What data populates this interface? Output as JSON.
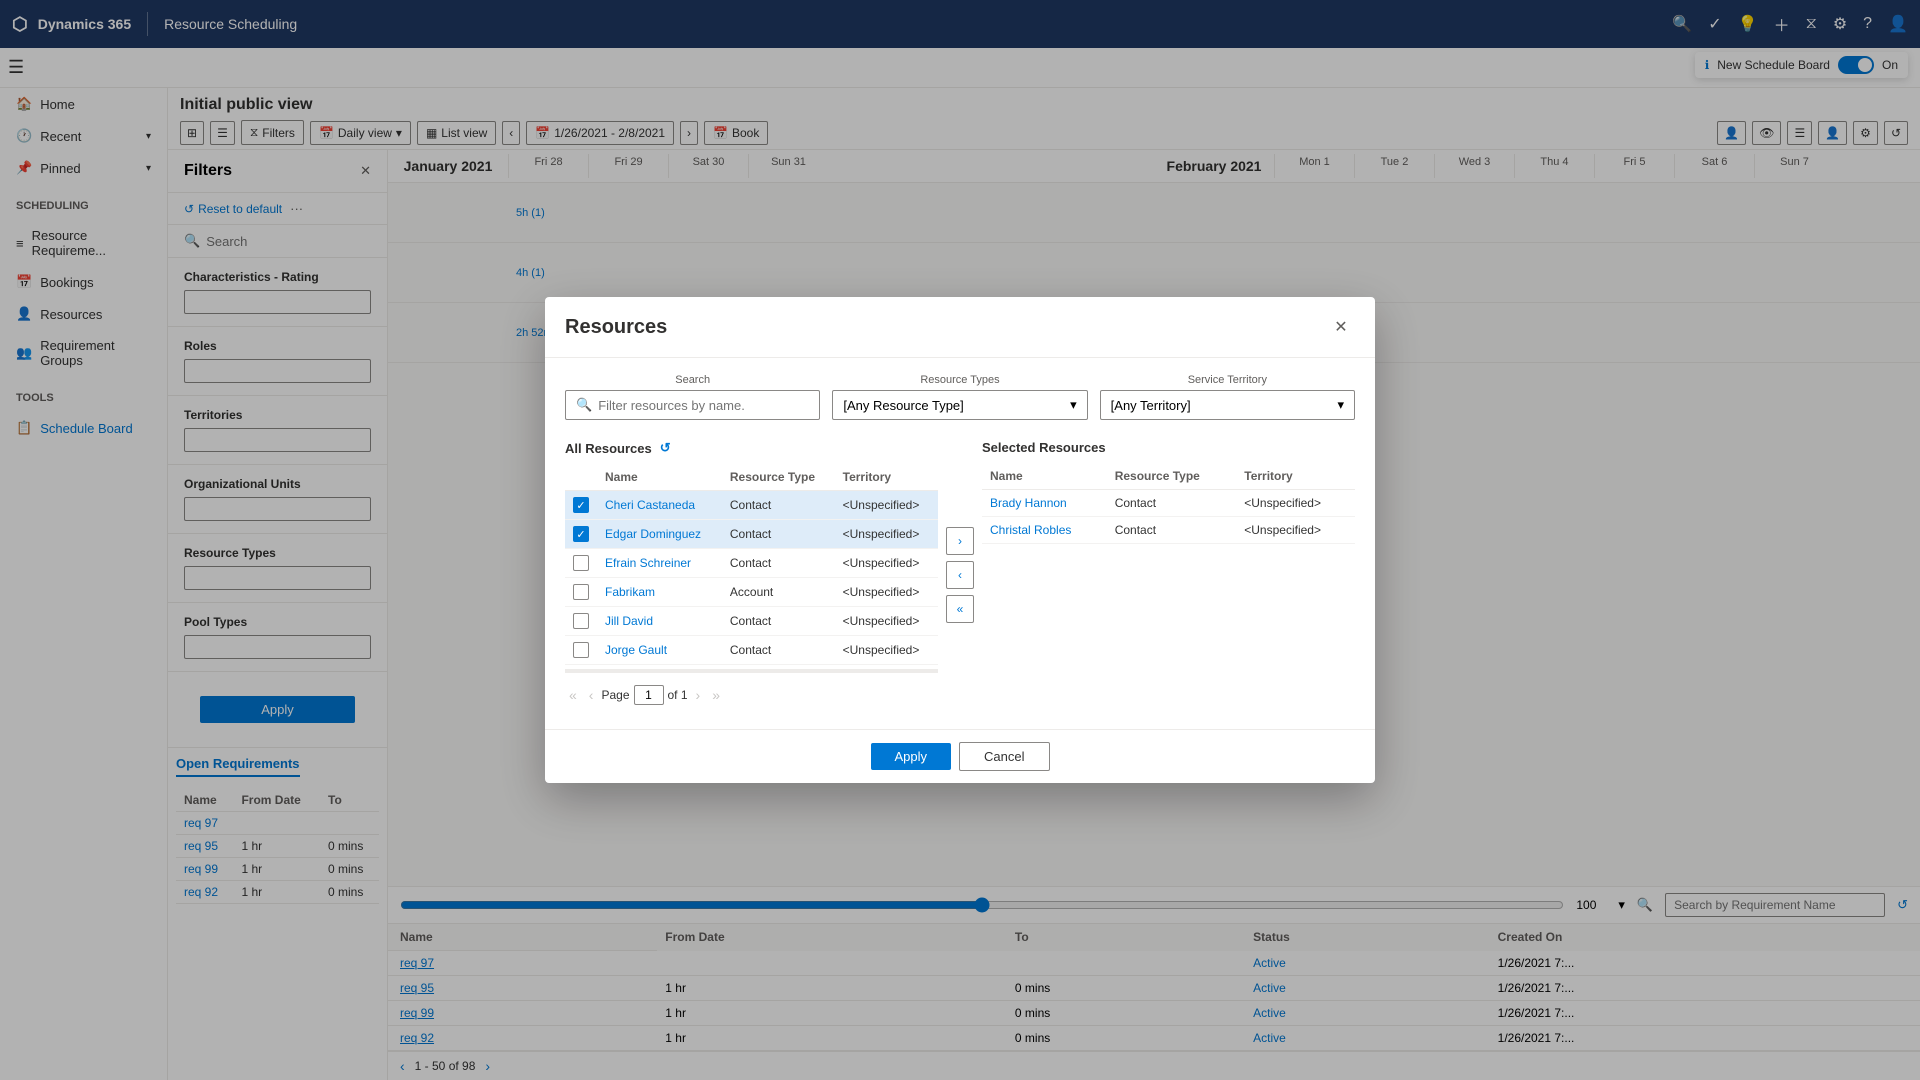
{
  "app": {
    "name": "Dynamics 365",
    "module": "Resource Scheduling"
  },
  "topbar": {
    "new_schedule_board_label": "New Schedule Board",
    "toggle_state": "On"
  },
  "sidebar": {
    "items": [
      {
        "id": "home",
        "label": "Home",
        "icon": "🏠"
      },
      {
        "id": "recent",
        "label": "Recent",
        "icon": "🕐",
        "hasChevron": true
      },
      {
        "id": "pinned",
        "label": "Pinned",
        "icon": "📌",
        "hasChevron": true
      },
      {
        "id": "scheduling",
        "label": "Scheduling",
        "isSection": true
      },
      {
        "id": "resource-req",
        "label": "Resource Requireme...",
        "icon": "≡"
      },
      {
        "id": "bookings",
        "label": "Bookings",
        "icon": "📅"
      },
      {
        "id": "resources",
        "label": "Resources",
        "icon": "👤"
      },
      {
        "id": "req-groups",
        "label": "Requirement Groups",
        "icon": "👥"
      },
      {
        "id": "tools",
        "label": "Tools",
        "isSection": true
      },
      {
        "id": "schedule-board",
        "label": "Schedule Board",
        "icon": "📋",
        "active": true
      }
    ]
  },
  "board": {
    "page_title": "Initial public view",
    "toolbar": {
      "filters_label": "Filters",
      "daily_view_label": "Daily view",
      "list_view_label": "List view",
      "date_range": "1/26/2021 - 2/8/2021",
      "book_label": "Book"
    }
  },
  "filters_panel": {
    "title": "Filters",
    "reset_label": "Reset to default",
    "sections": [
      {
        "label": "Characteristics - Rating"
      },
      {
        "label": "Roles"
      },
      {
        "label": "Territories"
      },
      {
        "label": "Organizational Units"
      },
      {
        "label": "Resource Types"
      },
      {
        "label": "Pool Types"
      }
    ],
    "apply_label": "Apply"
  },
  "open_requirements": {
    "title": "Open Requirements",
    "columns": [
      "Name",
      "From Date",
      "To",
      ""
    ],
    "rows": [
      {
        "name": "req 97",
        "from_date": "",
        "to": "",
        "mins": "",
        "hr": ""
      },
      {
        "name": "req 95",
        "from_date": "1 hr",
        "to": "0 mins",
        "mins": "0 mins",
        "hr": "1 hr"
      },
      {
        "name": "req 99",
        "from_date": "1 hr",
        "to": "0 mins",
        "mins": "0 mins",
        "hr": "1 hr"
      },
      {
        "name": "req 92",
        "from_date": "1 hr",
        "to": "0 mins",
        "mins": "0 mins",
        "hr": "1 hr"
      }
    ],
    "extra_cols": [
      "Status",
      "Created On"
    ],
    "statuses": [
      "Active",
      "Active",
      "Active",
      "Active"
    ],
    "created_dates": [
      "1/26/2021 7:...",
      "1/26/2021 7:...",
      "1/26/2021 7:...",
      "1/26/2021 7:..."
    ],
    "pagination": "1 - 50 of 98"
  },
  "calendar": {
    "months": [
      "January 2021",
      "February 2021"
    ],
    "days": [
      {
        "label": "Fri 28"
      },
      {
        "label": "Fri 29"
      },
      {
        "label": "Sat 30"
      },
      {
        "label": "Sun 31"
      },
      {
        "label": "Mon 1"
      },
      {
        "label": "Tue 2"
      },
      {
        "label": "Wed 3"
      },
      {
        "label": "Thu 4"
      },
      {
        "label": "Fri 5"
      },
      {
        "label": "Sat 6"
      },
      {
        "label": "Sun 7"
      }
    ]
  },
  "search_panel": {
    "placeholder": "Search by Requirement Name"
  },
  "modal": {
    "title": "Resources",
    "search": {
      "label": "Search",
      "placeholder": "Filter resources by name."
    },
    "resource_types": {
      "label": "Resource Types",
      "value": "[Any Resource Type]"
    },
    "service_territory": {
      "label": "Service Territory",
      "value": "[Any Territory]"
    },
    "all_resources_label": "All Resources",
    "selected_resources_label": "Selected Resources",
    "table_headers": {
      "name": "Name",
      "resource_type": "Resource Type",
      "territory": "Territory"
    },
    "all_resources": [
      {
        "name": "Cheri Castaneda",
        "type": "Contact",
        "territory": "<Unspecified>",
        "checked": true
      },
      {
        "name": "Edgar Dominguez",
        "type": "Contact",
        "territory": "<Unspecified>",
        "checked": true
      },
      {
        "name": "Efrain Schreiner",
        "type": "Contact",
        "territory": "<Unspecified>",
        "checked": false
      },
      {
        "name": "Fabrikam",
        "type": "Account",
        "territory": "<Unspecified>",
        "checked": false
      },
      {
        "name": "Jill David",
        "type": "Contact",
        "territory": "<Unspecified>",
        "checked": false
      },
      {
        "name": "Jorge Gault",
        "type": "Contact",
        "territory": "<Unspecified>",
        "checked": false
      }
    ],
    "selected_resources": [
      {
        "name": "Brady Hannon",
        "type": "Contact",
        "territory": "<Unspecified>"
      },
      {
        "name": "Christal Robles",
        "type": "Contact",
        "territory": "<Unspecified>"
      }
    ],
    "pagination": {
      "page_label": "Page",
      "current_page": "1",
      "total_pages": "1"
    },
    "apply_label": "Apply",
    "cancel_label": "Cancel"
  }
}
